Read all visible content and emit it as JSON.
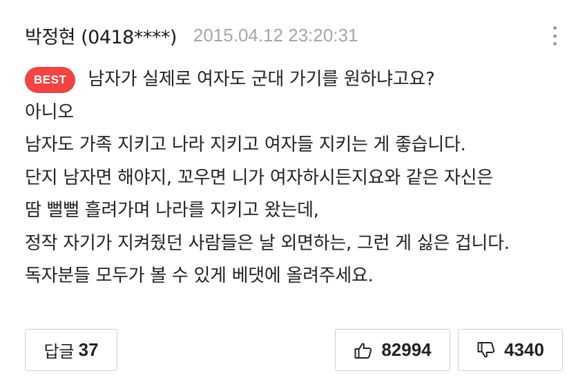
{
  "comment": {
    "author": "박정현 (0418****)",
    "timestamp": "2015.04.12 23:20:31",
    "more_icon": "vertical-ellipsis-icon",
    "badge": "BEST",
    "lines": [
      "남자가 실제로 여자도 군대 가기를 원하냐고요?",
      "아니오",
      "남자도 가족 지키고 나라 지키고 여자들 지키는 게 좋습니다.",
      "단지 남자면 해야지, 꼬우면 니가 여자하시든지요와 같은 자신은",
      "땀 뻘뻘 흘려가며 나라를 지키고 왔는데,",
      "정작 자기가 지켜줬던 사람들은 날 외면하는, 그런 게 싫은 겁니다.",
      "독자분들 모두가 볼 수 있게 베댓에 올려주세요."
    ]
  },
  "actions": {
    "reply_label": "답글",
    "reply_count": "37",
    "like_icon": "thumbs-up-icon",
    "like_count": "82994",
    "dislike_icon": "thumbs-down-icon",
    "dislike_count": "4340"
  },
  "colors": {
    "badge": "#ee4444",
    "timestamp": "#a6a6a6",
    "border": "#cfcfcf"
  }
}
